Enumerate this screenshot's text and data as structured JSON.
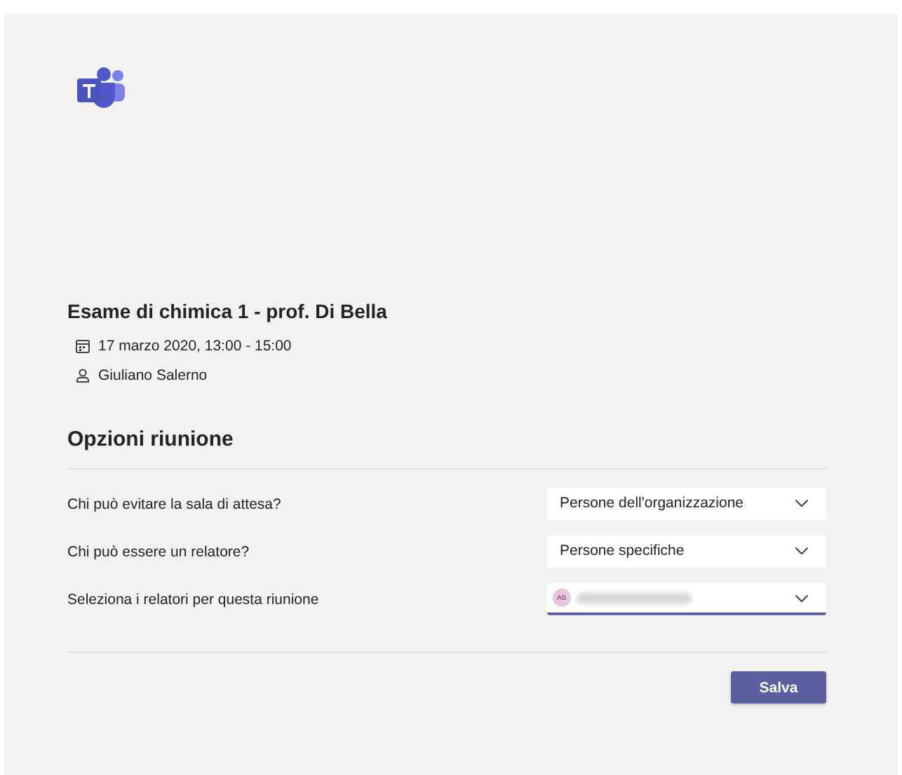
{
  "meeting": {
    "title": "Esame di chimica 1 - prof. Di Bella",
    "date": "17 marzo 2020, 13:00 - 15:00",
    "organizer": "Giuliano Salerno"
  },
  "options": {
    "heading": "Opzioni riunione",
    "rows": [
      {
        "kind": "dropdown",
        "label": "Chi può evitare la sala di attesa?",
        "value": "Persone dell'organizzazione",
        "focused": false
      },
      {
        "kind": "dropdown",
        "label": "Chi può essere un relatore?",
        "value": "Persone specifiche",
        "focused": false
      },
      {
        "kind": "people",
        "label": "Seleziona i relatori per questa riunione",
        "avatar": "AB",
        "focused": true
      }
    ]
  },
  "save_button": "Salva"
}
